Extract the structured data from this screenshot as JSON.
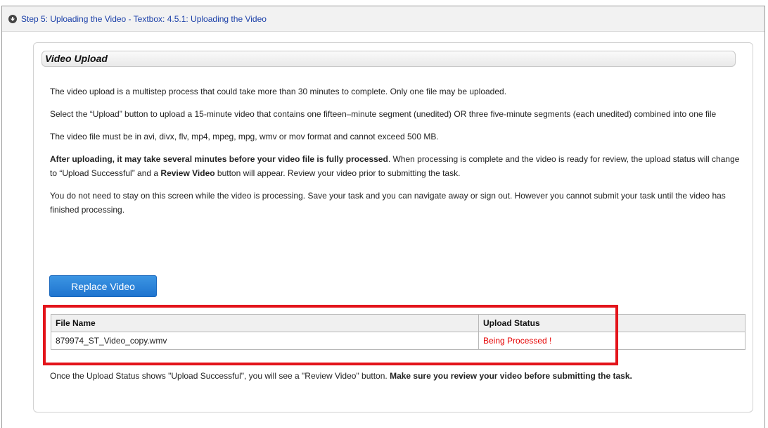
{
  "header": {
    "step_link": "Step 5: Uploading the Video - Textbox: 4.5.1: Uploading the Video",
    "icon": "circle-arrow-down-icon"
  },
  "panel": {
    "title": "Video Upload",
    "paragraphs": {
      "p1": "The video upload is a multistep process that could take more than 30 minutes to complete. Only one file may be uploaded.",
      "p2": "Select the “Upload” button to upload a 15-minute video that contains one fifteen–minute segment (unedited) OR three five-minute segments (each unedited) combined into one file",
      "p3": "The video file must be in avi, divx, flv, mp4, mpeg, mpg, wmv or mov format and cannot exceed 500 MB.",
      "p4_bold": "After uploading, it may take several minutes before your video file is fully processed",
      "p4_a": ". When processing is complete and the video is ready for review, the upload status will change to “Upload Successful” and a ",
      "p4_bold2": "Review Video",
      "p4_b": " button will appear. Review your video prior to submitting the task.",
      "p5": "You do not need to stay on this screen while the video is processing. Save your task and you can navigate away or sign out. However you cannot submit your task until the video has finished processing."
    },
    "replace_button": "Replace Video",
    "table": {
      "headers": [
        "File Name",
        "Upload Status"
      ],
      "rows": [
        {
          "file_name": "879974_ST_Video_copy.wmv",
          "status": "Being Processed !"
        }
      ]
    },
    "footer_note": "Once the Upload Status shows \"Upload Successful\", you will see a \"Review Video\" button. ",
    "footer_note_bold": "Make sure you review your video before submitting the task."
  },
  "colors": {
    "link": "#1a3fa8",
    "button": "#2a84d8",
    "status_processing": "#e60000",
    "highlight_box": "#e3141b"
  }
}
